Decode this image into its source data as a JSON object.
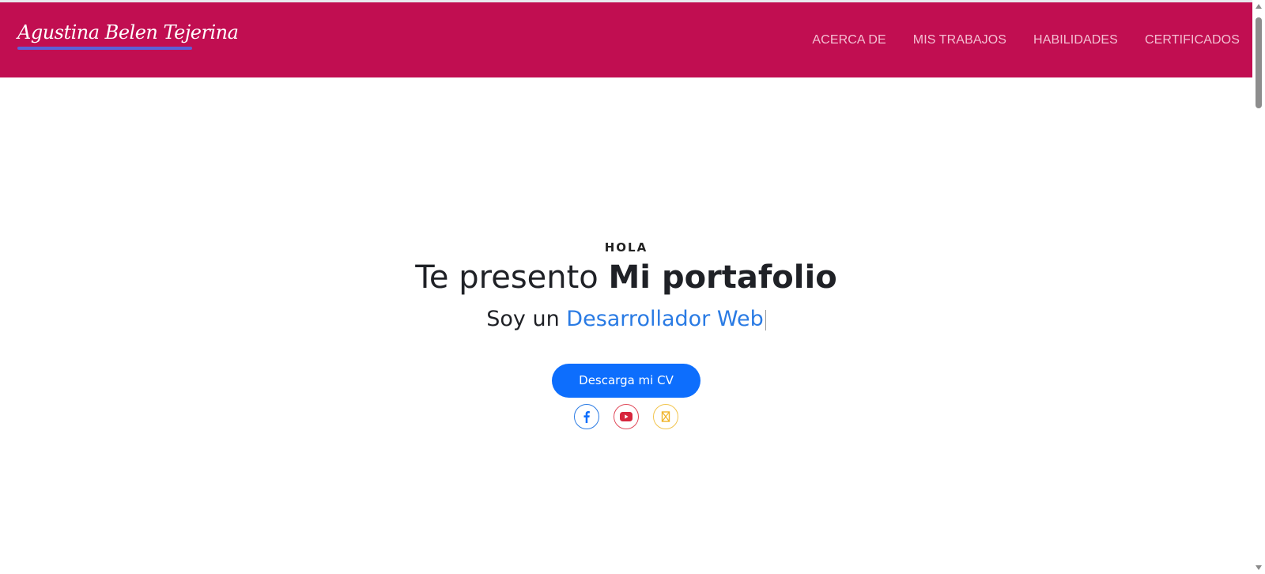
{
  "navbar": {
    "brand": "Agustina Belen Tejerina",
    "links": [
      "ACERCA DE",
      "MIS TRABAJOS",
      "HABILIDADES",
      "CERTIFICADOS"
    ],
    "bg_color": "#c10e51"
  },
  "hero": {
    "greeting": "HOLA",
    "headline_prefix": "Te presento ",
    "headline_bold": "Mi portafolio",
    "subline_prefix": "Soy un ",
    "subline_role": "Desarrollador Web",
    "cv_button": "Descarga mi CV",
    "social_icons": [
      "facebook-icon",
      "youtube-icon",
      "instagram-icon"
    ]
  },
  "colors": {
    "accent": "#0d6efd",
    "role_text": "#2a7be4"
  }
}
